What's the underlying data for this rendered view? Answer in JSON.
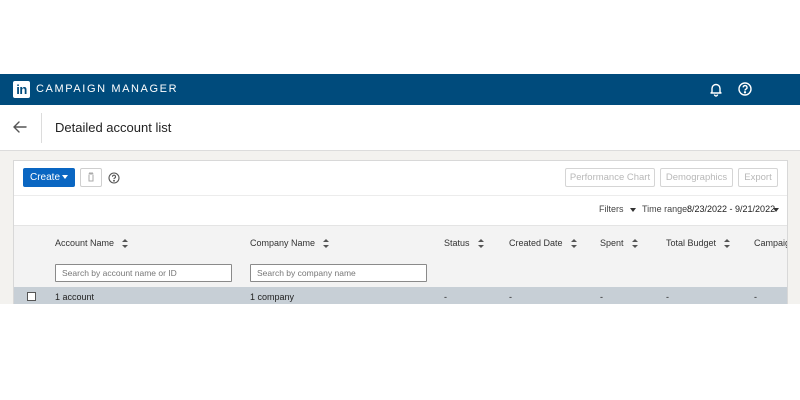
{
  "header": {
    "logo_text": "in",
    "app_title": "CAMPAIGN MANAGER",
    "icons": [
      "bell-icon",
      "help-icon"
    ]
  },
  "subheader": {
    "back_icon": "arrow-left-icon",
    "page_title": "Detailed account list"
  },
  "toolbar": {
    "create_label": "Create",
    "trash_icon": "trash-icon",
    "help_icon": "help-icon",
    "performance_chart_label": "Performance Chart",
    "demographics_label": "Demographics",
    "export_label": "Export"
  },
  "filters": {
    "filters_label": "Filters",
    "time_range_label": "Time range:",
    "time_range_value": "8/23/2022 - 9/21/2022"
  },
  "table": {
    "columns": [
      {
        "label": "Account Name"
      },
      {
        "label": "Company Name"
      },
      {
        "label": "Status"
      },
      {
        "label": "Created Date"
      },
      {
        "label": "Spent"
      },
      {
        "label": "Total Budget"
      },
      {
        "label": "Campaign"
      }
    ],
    "search_account_placeholder": "Search by account name or ID",
    "search_company_placeholder": "Search by company name",
    "summary_row": {
      "account": "1 account",
      "company": "1 company",
      "status": "-",
      "created": "-",
      "spent": "-",
      "budget": "-",
      "campaign": "-"
    }
  },
  "colors": {
    "topbar": "#004b7c",
    "primary_button": "#0a66c2",
    "summary_row": "#c7cfd6"
  }
}
